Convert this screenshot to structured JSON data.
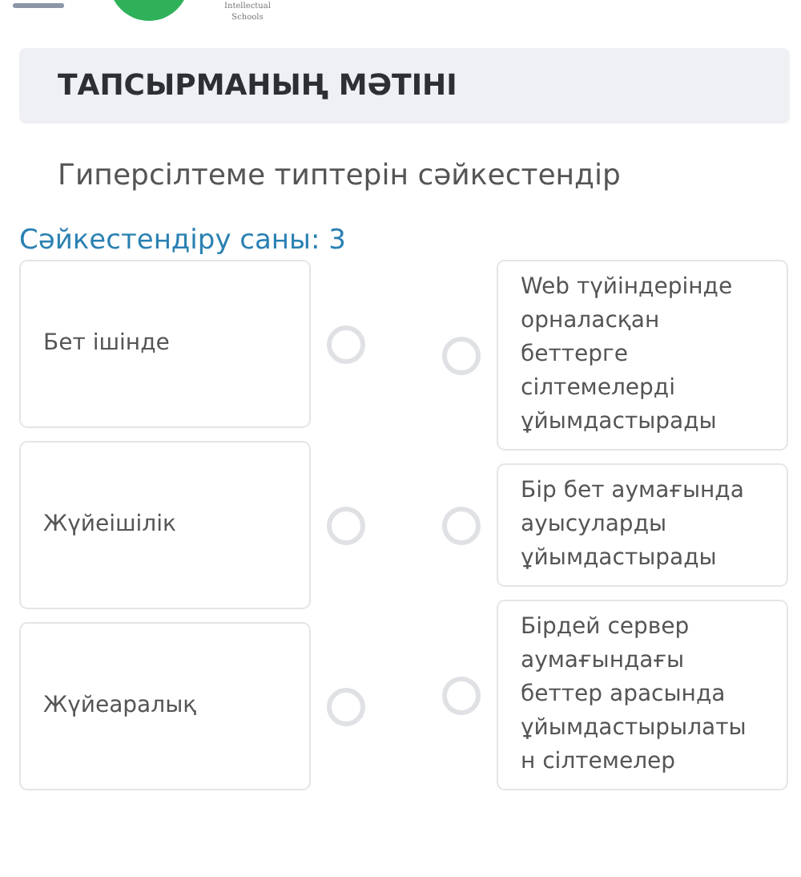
{
  "header": {
    "logo_text": [
      "Intellectual",
      "Schools"
    ]
  },
  "task_header": {
    "title": "ТАПСЫРМАНЫҢ МӘТІНІ"
  },
  "instruction": "Гиперсілтеме типтерін сәйкестендір",
  "match_count": "Сәйкестендіру саны: 3",
  "left_items": [
    {
      "text": "Бет ішінде",
      "selected": false
    },
    {
      "text": "Жүйеішілік",
      "selected": false
    },
    {
      "text": "Жүйеаралық",
      "selected": false
    }
  ],
  "right_items": [
    {
      "text": "Web түйіндерінде орналасқан беттерге сілтемелерді ұйымдастырады",
      "selected": false
    },
    {
      "text": "Бір бет аумағында ауысуларды ұйымдастырады",
      "selected": false
    },
    {
      "text": "Бірдей сервер аумағындағы беттер арасында ұйымдастырылаты н сілтемелер",
      "selected": false
    }
  ]
}
